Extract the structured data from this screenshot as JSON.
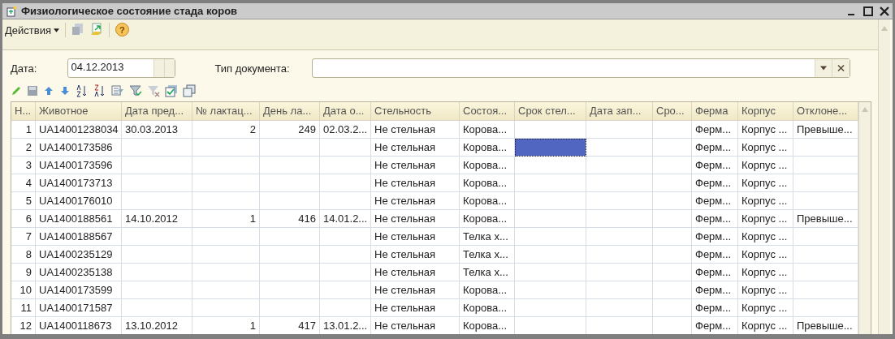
{
  "window": {
    "title": "Физиологическое состояние стада коров"
  },
  "toolbar": {
    "actions_menu": "Действия",
    "help": "?"
  },
  "form": {
    "date_label": "Дата:",
    "date_value": "04.12.2013",
    "doc_type_label": "Тип документа:"
  },
  "table": {
    "columns": [
      "Н...",
      "Животное",
      "Дата пред...",
      "№ лактац...",
      "День ла...",
      "Дата о...",
      "Стельность",
      "Состоя...",
      "Срок стел...",
      "Дата зап...",
      "Сро...",
      "Ферма",
      "Корпус",
      "Отклоне..."
    ],
    "rows": [
      {
        "cells": [
          {
            "text": "1",
            "selected": false
          },
          {
            "text": "UA14001238034",
            "selected": false
          },
          {
            "text": "30.03.2013",
            "selected": false
          },
          {
            "text": "2",
            "selected": false
          },
          {
            "text": "249",
            "selected": false
          },
          {
            "text": "02.03.2...",
            "selected": false
          },
          {
            "text": "Не стельная",
            "selected": false
          },
          {
            "text": "Корова...",
            "selected": false
          },
          {
            "text": "",
            "selected": false
          },
          {
            "text": "",
            "selected": false
          },
          {
            "text": "",
            "selected": false
          },
          {
            "text": "Ферм...",
            "selected": false
          },
          {
            "text": "Корпус ...",
            "selected": false
          },
          {
            "text": "Превыше...",
            "selected": false
          }
        ]
      },
      {
        "cells": [
          {
            "text": "2",
            "selected": false
          },
          {
            "text": "UA1400173586",
            "selected": false
          },
          {
            "text": "",
            "selected": false
          },
          {
            "text": "",
            "selected": false
          },
          {
            "text": "",
            "selected": false
          },
          {
            "text": "",
            "selected": false
          },
          {
            "text": "Не стельная",
            "selected": false
          },
          {
            "text": "Корова...",
            "selected": false
          },
          {
            "text": "",
            "selected": true
          },
          {
            "text": "",
            "selected": false
          },
          {
            "text": "",
            "selected": false
          },
          {
            "text": "Ферм...",
            "selected": false
          },
          {
            "text": "Корпус ...",
            "selected": false
          },
          {
            "text": "",
            "selected": false
          }
        ]
      },
      {
        "cells": [
          {
            "text": "3",
            "selected": false
          },
          {
            "text": "UA1400173596",
            "selected": false
          },
          {
            "text": "",
            "selected": false
          },
          {
            "text": "",
            "selected": false
          },
          {
            "text": "",
            "selected": false
          },
          {
            "text": "",
            "selected": false
          },
          {
            "text": "Не стельная",
            "selected": false
          },
          {
            "text": "Корова...",
            "selected": false
          },
          {
            "text": "",
            "selected": false
          },
          {
            "text": "",
            "selected": false
          },
          {
            "text": "",
            "selected": false
          },
          {
            "text": "Ферм...",
            "selected": false
          },
          {
            "text": "Корпус ...",
            "selected": false
          },
          {
            "text": "",
            "selected": false
          }
        ]
      },
      {
        "cells": [
          {
            "text": "4",
            "selected": false
          },
          {
            "text": "UA1400173713",
            "selected": false
          },
          {
            "text": "",
            "selected": false
          },
          {
            "text": "",
            "selected": false
          },
          {
            "text": "",
            "selected": false
          },
          {
            "text": "",
            "selected": false
          },
          {
            "text": "Не стельная",
            "selected": false
          },
          {
            "text": "Корова...",
            "selected": false
          },
          {
            "text": "",
            "selected": false
          },
          {
            "text": "",
            "selected": false
          },
          {
            "text": "",
            "selected": false
          },
          {
            "text": "Ферм...",
            "selected": false
          },
          {
            "text": "Корпус ...",
            "selected": false
          },
          {
            "text": "",
            "selected": false
          }
        ]
      },
      {
        "cells": [
          {
            "text": "5",
            "selected": false
          },
          {
            "text": "UA1400176010",
            "selected": false
          },
          {
            "text": "",
            "selected": false
          },
          {
            "text": "",
            "selected": false
          },
          {
            "text": "",
            "selected": false
          },
          {
            "text": "",
            "selected": false
          },
          {
            "text": "Не стельная",
            "selected": false
          },
          {
            "text": "Корова...",
            "selected": false
          },
          {
            "text": "",
            "selected": false
          },
          {
            "text": "",
            "selected": false
          },
          {
            "text": "",
            "selected": false
          },
          {
            "text": "Ферм...",
            "selected": false
          },
          {
            "text": "Корпус ...",
            "selected": false
          },
          {
            "text": "",
            "selected": false
          }
        ]
      },
      {
        "cells": [
          {
            "text": "6",
            "selected": false
          },
          {
            "text": "UA1400188561",
            "selected": false
          },
          {
            "text": "14.10.2012",
            "selected": false
          },
          {
            "text": "1",
            "selected": false
          },
          {
            "text": "416",
            "selected": false
          },
          {
            "text": "14.01.2...",
            "selected": false
          },
          {
            "text": "Не стельная",
            "selected": false
          },
          {
            "text": "Корова...",
            "selected": false
          },
          {
            "text": "",
            "selected": false
          },
          {
            "text": "",
            "selected": false
          },
          {
            "text": "",
            "selected": false
          },
          {
            "text": "Ферм...",
            "selected": false
          },
          {
            "text": "Корпус ...",
            "selected": false
          },
          {
            "text": "Превыше...",
            "selected": false
          }
        ]
      },
      {
        "cells": [
          {
            "text": "7",
            "selected": false
          },
          {
            "text": "UA1400188567",
            "selected": false
          },
          {
            "text": "",
            "selected": false
          },
          {
            "text": "",
            "selected": false
          },
          {
            "text": "",
            "selected": false
          },
          {
            "text": "",
            "selected": false
          },
          {
            "text": "Не стельная",
            "selected": false
          },
          {
            "text": "Телка х...",
            "selected": false
          },
          {
            "text": "",
            "selected": false
          },
          {
            "text": "",
            "selected": false
          },
          {
            "text": "",
            "selected": false
          },
          {
            "text": "Ферм...",
            "selected": false
          },
          {
            "text": "Корпус ...",
            "selected": false
          },
          {
            "text": "",
            "selected": false
          }
        ]
      },
      {
        "cells": [
          {
            "text": "8",
            "selected": false
          },
          {
            "text": "UA1400235129",
            "selected": false
          },
          {
            "text": "",
            "selected": false
          },
          {
            "text": "",
            "selected": false
          },
          {
            "text": "",
            "selected": false
          },
          {
            "text": "",
            "selected": false
          },
          {
            "text": "Не стельная",
            "selected": false
          },
          {
            "text": "Телка х...",
            "selected": false
          },
          {
            "text": "",
            "selected": false
          },
          {
            "text": "",
            "selected": false
          },
          {
            "text": "",
            "selected": false
          },
          {
            "text": "Ферм...",
            "selected": false
          },
          {
            "text": "Корпус ...",
            "selected": false
          },
          {
            "text": "",
            "selected": false
          }
        ]
      },
      {
        "cells": [
          {
            "text": "9",
            "selected": false
          },
          {
            "text": "UA1400235138",
            "selected": false
          },
          {
            "text": "",
            "selected": false
          },
          {
            "text": "",
            "selected": false
          },
          {
            "text": "",
            "selected": false
          },
          {
            "text": "",
            "selected": false
          },
          {
            "text": "Не стельная",
            "selected": false
          },
          {
            "text": "Телка х...",
            "selected": false
          },
          {
            "text": "",
            "selected": false
          },
          {
            "text": "",
            "selected": false
          },
          {
            "text": "",
            "selected": false
          },
          {
            "text": "Ферм...",
            "selected": false
          },
          {
            "text": "Корпус ...",
            "selected": false
          },
          {
            "text": "",
            "selected": false
          }
        ]
      },
      {
        "cells": [
          {
            "text": "10",
            "selected": false
          },
          {
            "text": "UA1400173599",
            "selected": false
          },
          {
            "text": "",
            "selected": false
          },
          {
            "text": "",
            "selected": false
          },
          {
            "text": "",
            "selected": false
          },
          {
            "text": "",
            "selected": false
          },
          {
            "text": "Не стельная",
            "selected": false
          },
          {
            "text": "Корова...",
            "selected": false
          },
          {
            "text": "",
            "selected": false
          },
          {
            "text": "",
            "selected": false
          },
          {
            "text": "",
            "selected": false
          },
          {
            "text": "Ферм...",
            "selected": false
          },
          {
            "text": "Корпус ...",
            "selected": false
          },
          {
            "text": "",
            "selected": false
          }
        ]
      },
      {
        "cells": [
          {
            "text": "11",
            "selected": false
          },
          {
            "text": "UA1400171587",
            "selected": false
          },
          {
            "text": "",
            "selected": false
          },
          {
            "text": "",
            "selected": false
          },
          {
            "text": "",
            "selected": false
          },
          {
            "text": "",
            "selected": false
          },
          {
            "text": "Не стельная",
            "selected": false
          },
          {
            "text": "Корова...",
            "selected": false
          },
          {
            "text": "",
            "selected": false
          },
          {
            "text": "",
            "selected": false
          },
          {
            "text": "",
            "selected": false
          },
          {
            "text": "Ферм...",
            "selected": false
          },
          {
            "text": "Корпус ...",
            "selected": false
          },
          {
            "text": "",
            "selected": false
          }
        ]
      },
      {
        "cells": [
          {
            "text": "12",
            "selected": false
          },
          {
            "text": "UA1400118673",
            "selected": false
          },
          {
            "text": "13.10.2012",
            "selected": false
          },
          {
            "text": "1",
            "selected": false
          },
          {
            "text": "417",
            "selected": false
          },
          {
            "text": "13.01.2...",
            "selected": false
          },
          {
            "text": "Не стельная",
            "selected": false
          },
          {
            "text": "Корова...",
            "selected": false
          },
          {
            "text": "",
            "selected": false
          },
          {
            "text": "",
            "selected": false
          },
          {
            "text": "",
            "selected": false
          },
          {
            "text": "Ферм...",
            "selected": false
          },
          {
            "text": "Корпус ...",
            "selected": false
          },
          {
            "text": "Превыше...",
            "selected": false
          }
        ]
      }
    ]
  }
}
